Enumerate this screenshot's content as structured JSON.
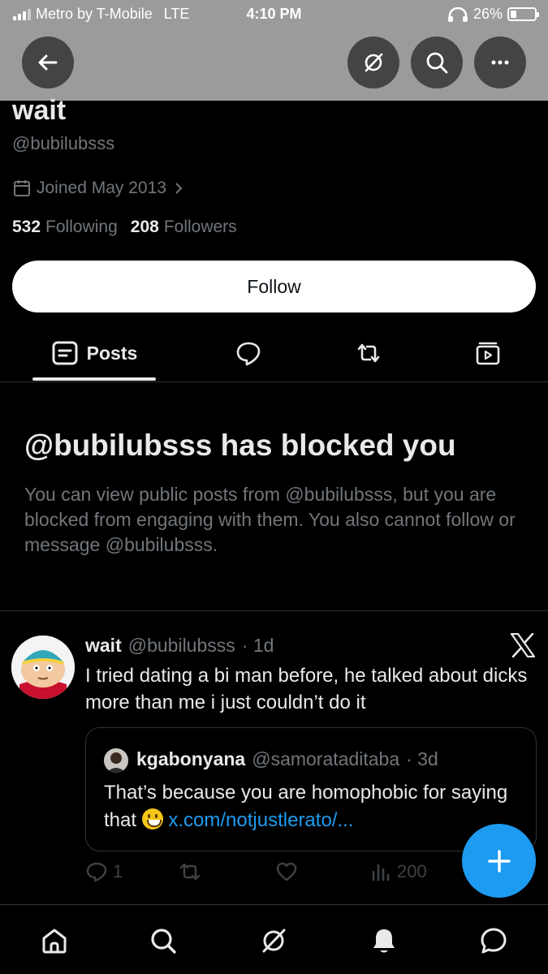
{
  "status_bar": {
    "carrier": "Metro by T-Mobile",
    "network": "LTE",
    "time": "4:10 PM",
    "battery": "26%",
    "battery_level": 0.26
  },
  "header": {
    "buttons": [
      "back-arrow-icon",
      "grok-icon",
      "search-icon",
      "more-icon"
    ]
  },
  "profile": {
    "name": "wait",
    "handle": "@bubilubsss",
    "joined": "Joined May 2013",
    "following_count": "532",
    "following_label": "Following",
    "followers_count": "208",
    "followers_label": "Followers",
    "follow_button": "Follow"
  },
  "tabs": {
    "posts_label": "Posts"
  },
  "blocked": {
    "title": "@bubilubsss has blocked you",
    "description": "You can view public posts from @bubilubsss, but you are blocked from engaging with them. You also cannot follow or message @bubilubsss."
  },
  "tweet": {
    "name": "wait",
    "handle": "@bubilubsss",
    "time": "· 1d",
    "text": "I tried dating a bi man before, he talked about dicks more than me i just couldn’t do it",
    "quote": {
      "name": "kgabonyana",
      "handle": "@samorataditaba",
      "time": "· 3d",
      "text": "That’s because you are homophobic for saying that",
      "link": "x.com/notjustlerato/..."
    },
    "replies": "1",
    "views": "200"
  },
  "colors": {
    "accent": "#1d9bf0",
    "background": "#000000",
    "secondary_text": "#71767b",
    "header_bg": "#9b9b9b"
  }
}
